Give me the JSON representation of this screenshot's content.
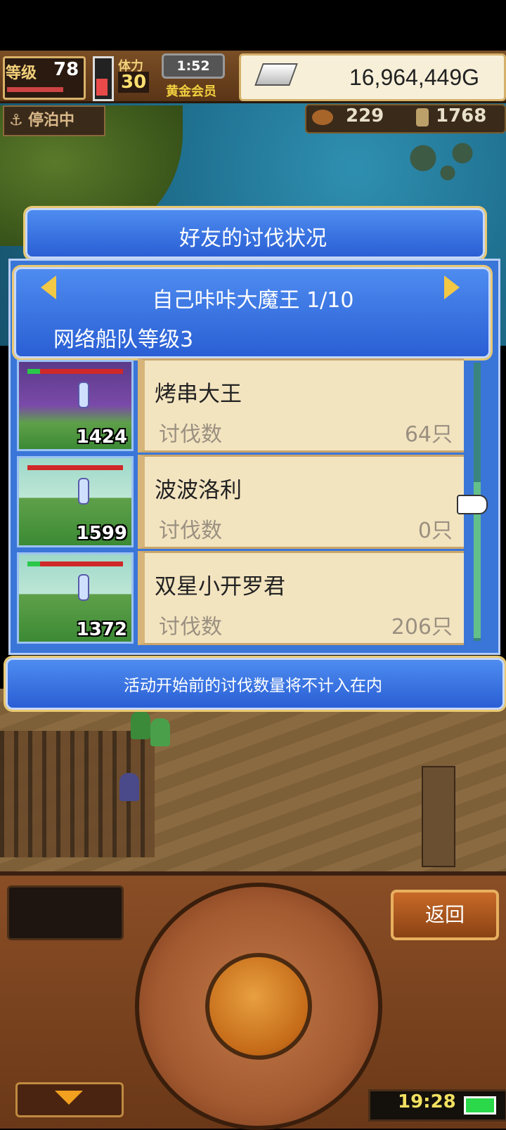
{
  "hud": {
    "level_label": "等级",
    "level_value": "78",
    "stamina_label": "体力",
    "stamina_value": "30",
    "timer": "1:52",
    "membership": "黄金会员",
    "gold": "16,964,449G",
    "mooring": "停泊中",
    "resource1": "229",
    "resource2": "1768"
  },
  "dialog": {
    "title": "好友的讨伐状况",
    "header_title": "自己咔咔大魔王 1/10",
    "header_sub": "网络船队等级3",
    "rows": [
      {
        "thumb_number": "1424",
        "name": "烤串大王",
        "label": "讨伐数",
        "count": "64只"
      },
      {
        "thumb_number": "1599",
        "name": "波波洛利",
        "label": "讨伐数",
        "count": "0只"
      },
      {
        "thumb_number": "1372",
        "name": "双星小开罗君",
        "label": "讨伐数",
        "count": "206只"
      }
    ],
    "notice": "活动开始前的讨伐数量将不计入在内"
  },
  "controls": {
    "back_label": "返回",
    "clock": "19:28"
  },
  "icons": {
    "anchor": "anchor-icon",
    "silver_bar": "silver-bar-icon",
    "prev": "arrow-left-icon",
    "next": "arrow-right-icon",
    "hand": "pointer-hand-icon",
    "battery": "battery-icon"
  },
  "colors": {
    "panel_blue": "#2a5fd4",
    "card_bg": "#f3e4c0",
    "accent_gold": "#f2c844"
  }
}
